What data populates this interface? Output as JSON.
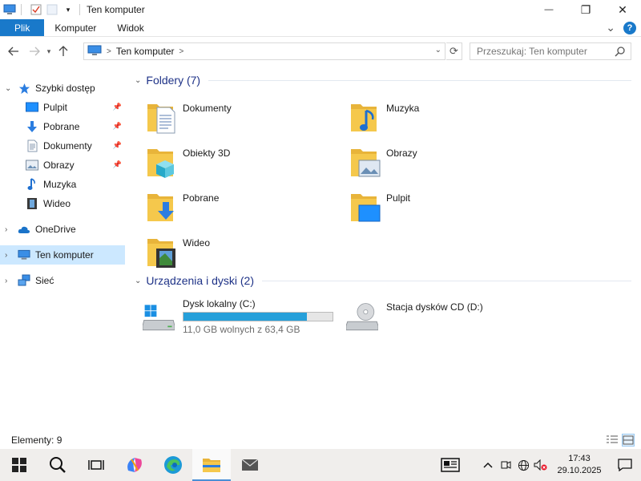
{
  "window": {
    "title": "Ten komputer",
    "minimize_glyph": "—",
    "maximize_glyph": "❐",
    "close_glyph": "✕"
  },
  "ribbon": {
    "tabs": [
      "Plik",
      "Komputer",
      "Widok"
    ],
    "expand_glyph": "⌄",
    "help_glyph": "?"
  },
  "address": {
    "path": "Ten komputer",
    "search_placeholder": "Przeszukaj: Ten komputer"
  },
  "nav_pane": {
    "quick_access": "Szybki dostęp",
    "quick_items": [
      "Pulpit",
      "Pobrane",
      "Dokumenty",
      "Obrazy",
      "Muzyka",
      "Wideo"
    ],
    "onedrive": "OneDrive",
    "this_pc": "Ten komputer",
    "network": "Sieć"
  },
  "content": {
    "folders_header": "Foldery (7)",
    "folders": [
      "Dokumenty",
      "Muzyka",
      "Obiekty 3D",
      "Obrazy",
      "Pobrane",
      "Pulpit",
      "Wideo"
    ],
    "devices_header": "Urządzenia i dyski (2)",
    "drives": [
      {
        "name": "Dysk lokalny (C:)",
        "free_text": "11,0 GB wolnych z 63,4 GB",
        "used_fraction": 0.827
      },
      {
        "name": "Stacja dysków CD (D:)"
      }
    ]
  },
  "status": {
    "items_text": "Elementy: 9"
  },
  "taskbar": {
    "time": "17:43",
    "date": "29.10.2025"
  },
  "colors": {
    "accent": "#1979ca",
    "selection": "#cce8ff",
    "group_header": "#1e3287",
    "drive_fill": "#26a0da",
    "folder": "#f5c84c"
  }
}
